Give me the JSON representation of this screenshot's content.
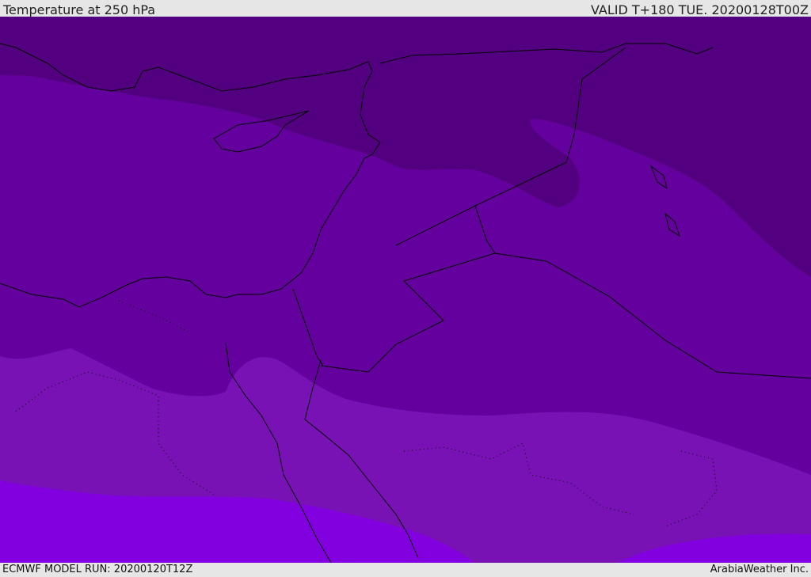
{
  "header": {
    "title": "Temperature at 250 hPa",
    "valid_time": "VALID T+180 TUE. 20200128T00Z"
  },
  "footer": {
    "model_run": "ECMWF MODEL RUN: 20200120T12Z",
    "credit": "ArabiaWeather Inc."
  },
  "colors": {
    "band_darkest": "#520080",
    "band_dark": "#64009d",
    "band_mid": "#7912b5",
    "band_bright": "#8200e0",
    "coastline": "#000000"
  }
}
